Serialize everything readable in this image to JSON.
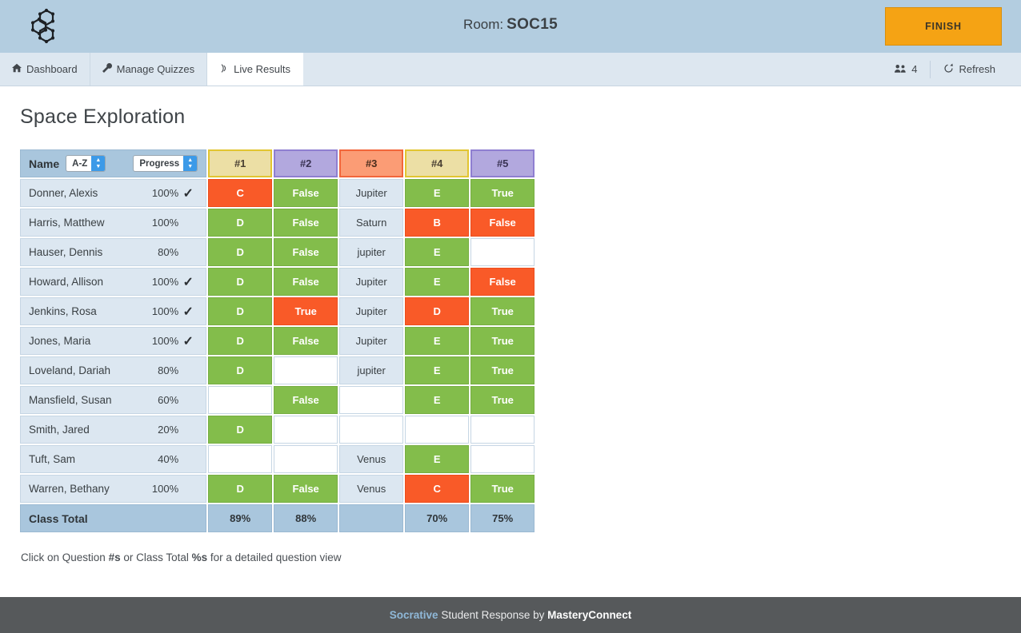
{
  "topbar": {
    "logo_name": "socrative-molecule-logo",
    "room_word": "Room:",
    "room_code": "SOC15",
    "finish_label": "FINISH"
  },
  "nav": {
    "tabs": [
      {
        "label": "Dashboard",
        "icon": "home-icon",
        "active": false
      },
      {
        "label": "Manage Quizzes",
        "icon": "wrench-icon",
        "active": false
      },
      {
        "label": "Live Results",
        "icon": "broadcast-icon",
        "active": true
      }
    ],
    "student_count": "4",
    "students_icon": "people-icon",
    "refresh_label": "Refresh",
    "refresh_icon": "refresh-icon"
  },
  "main": {
    "page_title": "Space Exploration",
    "hint_prefix": "Click on Question ",
    "hint_hash": "#s",
    "hint_middle": " or Class Total ",
    "hint_pct": "%s",
    "hint_suffix": " for a detailed question view"
  },
  "table": {
    "name_header_label": "Name",
    "sort_name_value": "A-Z",
    "sort_progress_value": "Progress",
    "question_headers": [
      {
        "label": "#1",
        "style": "k-yellow"
      },
      {
        "label": "#2",
        "style": "k-purple"
      },
      {
        "label": "#3",
        "style": "k-salmon"
      },
      {
        "label": "#4",
        "style": "k-yellow"
      },
      {
        "label": "#5",
        "style": "k-purple"
      }
    ],
    "rows": [
      {
        "name": "Donner, Alexis",
        "percent": "100%",
        "done": "✓",
        "answers": [
          {
            "t": "C",
            "s": "wrong"
          },
          {
            "t": "False",
            "s": "correct"
          },
          {
            "t": "Jupiter",
            "s": "neutral"
          },
          {
            "t": "E",
            "s": "correct"
          },
          {
            "t": "True",
            "s": "correct"
          }
        ]
      },
      {
        "name": "Harris, Matthew",
        "percent": "100%",
        "done": "",
        "answers": [
          {
            "t": "D",
            "s": "correct"
          },
          {
            "t": "False",
            "s": "correct"
          },
          {
            "t": "Saturn",
            "s": "neutral"
          },
          {
            "t": "B",
            "s": "wrong"
          },
          {
            "t": "False",
            "s": "wrong"
          }
        ]
      },
      {
        "name": "Hauser, Dennis",
        "percent": "80%",
        "done": "",
        "answers": [
          {
            "t": "D",
            "s": "correct"
          },
          {
            "t": "False",
            "s": "correct"
          },
          {
            "t": "jupiter",
            "s": "neutral"
          },
          {
            "t": "E",
            "s": "correct"
          },
          {
            "t": "",
            "s": "blank"
          }
        ]
      },
      {
        "name": "Howard, Allison",
        "percent": "100%",
        "done": "✓",
        "answers": [
          {
            "t": "D",
            "s": "correct"
          },
          {
            "t": "False",
            "s": "correct"
          },
          {
            "t": "Jupiter",
            "s": "neutral"
          },
          {
            "t": "E",
            "s": "correct"
          },
          {
            "t": "False",
            "s": "wrong"
          }
        ]
      },
      {
        "name": "Jenkins, Rosa",
        "percent": "100%",
        "done": "✓",
        "answers": [
          {
            "t": "D",
            "s": "correct"
          },
          {
            "t": "True",
            "s": "wrong"
          },
          {
            "t": "Jupiter",
            "s": "neutral"
          },
          {
            "t": "D",
            "s": "wrong"
          },
          {
            "t": "True",
            "s": "correct"
          }
        ]
      },
      {
        "name": "Jones, Maria",
        "percent": "100%",
        "done": "✓",
        "answers": [
          {
            "t": "D",
            "s": "correct"
          },
          {
            "t": "False",
            "s": "correct"
          },
          {
            "t": "Jupiter",
            "s": "neutral"
          },
          {
            "t": "E",
            "s": "correct"
          },
          {
            "t": "True",
            "s": "correct"
          }
        ]
      },
      {
        "name": "Loveland, Dariah",
        "percent": "80%",
        "done": "",
        "answers": [
          {
            "t": "D",
            "s": "correct"
          },
          {
            "t": "",
            "s": "blank"
          },
          {
            "t": "jupiter",
            "s": "neutral"
          },
          {
            "t": "E",
            "s": "correct"
          },
          {
            "t": "True",
            "s": "correct"
          }
        ]
      },
      {
        "name": "Mansfield, Susan",
        "percent": "60%",
        "done": "",
        "answers": [
          {
            "t": "",
            "s": "blank"
          },
          {
            "t": "False",
            "s": "correct"
          },
          {
            "t": "",
            "s": "blank"
          },
          {
            "t": "E",
            "s": "correct"
          },
          {
            "t": "True",
            "s": "correct"
          }
        ]
      },
      {
        "name": "Smith, Jared",
        "percent": "20%",
        "done": "",
        "answers": [
          {
            "t": "D",
            "s": "correct"
          },
          {
            "t": "",
            "s": "blank"
          },
          {
            "t": "",
            "s": "blank"
          },
          {
            "t": "",
            "s": "blank"
          },
          {
            "t": "",
            "s": "blank"
          }
        ]
      },
      {
        "name": "Tuft, Sam",
        "percent": "40%",
        "done": "",
        "answers": [
          {
            "t": "",
            "s": "blank"
          },
          {
            "t": "",
            "s": "blank"
          },
          {
            "t": "Venus",
            "s": "neutral"
          },
          {
            "t": "E",
            "s": "correct"
          },
          {
            "t": "",
            "s": "blank"
          }
        ]
      },
      {
        "name": "Warren, Bethany",
        "percent": "100%",
        "done": "",
        "answers": [
          {
            "t": "D",
            "s": "correct"
          },
          {
            "t": "False",
            "s": "correct"
          },
          {
            "t": "Venus",
            "s": "neutral"
          },
          {
            "t": "C",
            "s": "wrong"
          },
          {
            "t": "True",
            "s": "correct"
          }
        ]
      }
    ],
    "class_total_label": "Class Total",
    "class_totals": [
      "89%",
      "88%",
      "",
      "70%",
      "75%"
    ]
  },
  "footer": {
    "brand": "Socrative",
    "middle": " Student Response by ",
    "company": "MasteryConnect"
  },
  "colors": {
    "topbar_bg": "#b3cde0",
    "accent_orange": "#f5a314",
    "correct_green": "#83bd4b",
    "wrong_red": "#f95a28",
    "neutral_blue": "#dce7f1",
    "header_blue": "#a9c6dd",
    "footer_gray": "#56595b",
    "select_blue": "#3c9ae8"
  }
}
